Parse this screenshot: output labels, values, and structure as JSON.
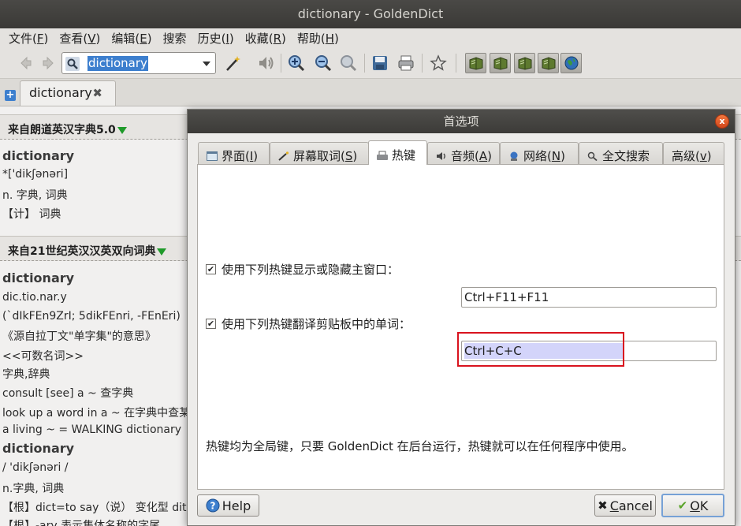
{
  "window": {
    "title": "dictionary - GoldenDict"
  },
  "menu": [
    {
      "label": "文件(",
      "key": "F",
      "end": ")"
    },
    {
      "label": "查看(",
      "key": "V",
      "end": ")"
    },
    {
      "label": "编辑(",
      "key": "E",
      "end": ")"
    },
    {
      "label": "搜索",
      "key": "",
      "end": ""
    },
    {
      "label": "历史(",
      "key": "I",
      "end": ")"
    },
    {
      "label": "收藏(",
      "key": "R",
      "end": ")"
    },
    {
      "label": "帮助(",
      "key": "H",
      "end": ")"
    }
  ],
  "toolbar": {
    "search_value": "dictionary"
  },
  "tab": {
    "label": "dictionary",
    "close_glyph": "✖"
  },
  "article": {
    "dict1": {
      "name": "来自朗道英汉字典5.0",
      "lines": [
        "dictionary",
        "*['dikʃənəri]",
        "n. 字典, 词典",
        "【计】 词典"
      ]
    },
    "dict2": {
      "name": "来自21世纪英汉汉英双向词典",
      "lines": [
        "dictionary",
        "dic.tio.nar.y",
        "(`dIkFEn9ZrI; 5dikFEnri, -FEnEri)",
        "《源自拉丁文\"单字集\"的意思》",
        "<<可数名词>>",
        "字典,辞典",
        "consult [see] a ~ 查字典",
        "look up a word in a ~ 在字典中查某一个",
        "a living ~ = WALKING dictionary",
        "dictionary",
        "/ 'dikʃənəri /",
        "n.字典, 词典",
        "【根】dict=to say（说） 变化型 dit",
        "【根】-ary 表示集体名称的字尾"
      ]
    }
  },
  "dialog": {
    "title": "首选项",
    "close_glyph": "x",
    "tabs": [
      {
        "label": "界面(",
        "key": "I",
        "end": ")"
      },
      {
        "label": "屏幕取词(",
        "key": "S",
        "end": ")"
      },
      {
        "label": "热键",
        "key": "",
        "end": ""
      },
      {
        "label": "音频(",
        "key": "A",
        "end": ")"
      },
      {
        "label": "网络(",
        "key": "N",
        "end": ")"
      },
      {
        "label": "全文搜索",
        "key": "",
        "end": ""
      },
      {
        "label": "高级(",
        "key": "v",
        "end": ")"
      }
    ],
    "hotkeys": {
      "main_window_label": "使用下列热键显示或隐藏主窗口：",
      "main_window_checked": true,
      "main_window_value": "Ctrl+F11+F11",
      "clipboard_label": "使用下列热键翻译剪贴板中的单词：",
      "clipboard_checked": true,
      "clipboard_value": "Ctrl+C+C",
      "note": "热键均为全局键，只要 GoldenDict 在后台运行，热键就可以在任何程序中使用。"
    },
    "buttons": {
      "help": "Help",
      "cancel_pre": "",
      "cancel_key": "C",
      "cancel_post": "ancel",
      "ok_pre": "",
      "ok_key": "O",
      "ok_post": "K"
    }
  }
}
